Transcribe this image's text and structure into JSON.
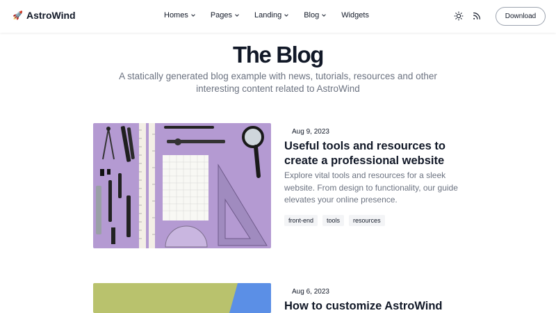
{
  "header": {
    "logo_text": "AstroWind",
    "logo_icon": "rocket-icon",
    "nav": [
      {
        "label": "Homes",
        "has_dropdown": true
      },
      {
        "label": "Pages",
        "has_dropdown": true
      },
      {
        "label": "Landing",
        "has_dropdown": true
      },
      {
        "label": "Blog",
        "has_dropdown": true
      },
      {
        "label": "Widgets",
        "has_dropdown": false
      }
    ],
    "theme_icon": "sun-icon",
    "rss_icon": "rss-icon",
    "download_label": "Download"
  },
  "hero": {
    "title": "The Blog",
    "subtitle": "A statically generated blog example with news, tutorials, resources and other interesting content related to AstroWind"
  },
  "posts": [
    {
      "date": "Aug 9, 2023",
      "title": "Useful tools and resources to create a professional website",
      "excerpt": "Explore vital tools and resources for a sleek website. From design to functionality, our guide elevates your online presence.",
      "tags": [
        "front-end",
        "tools",
        "resources"
      ]
    },
    {
      "date": "Aug 6, 2023",
      "title": "How to customize AstroWind"
    }
  ],
  "colors": {
    "text": "#111827",
    "muted": "#6b7280",
    "tag_bg": "#f3f4f6",
    "image1_bg": "#b49ad2",
    "image2_green": "#b9c26d",
    "image2_blue": "#5b8fe6"
  }
}
